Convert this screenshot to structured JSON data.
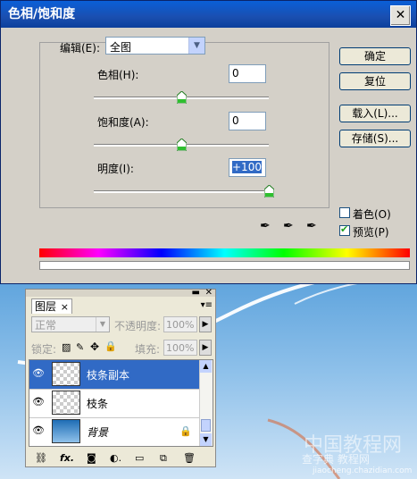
{
  "dialog": {
    "title": "色相/饱和度",
    "close_glyph": "✕",
    "edit_label": "编辑(E):",
    "edit_value": "全图",
    "hue_label": "色相(H):",
    "hue_value": "0",
    "saturation_label": "饱和度(A):",
    "saturation_value": "0",
    "lightness_label": "明度(I):",
    "lightness_value": "+100",
    "hue_level": 0.5,
    "saturation_level": 0.5,
    "lightness_level": 1.0,
    "buttons": {
      "ok": "确定",
      "reset": "复位",
      "load": "载入(L)...",
      "save": "存储(S)..."
    },
    "colorize_label": "着色(O)",
    "colorize_checked": false,
    "preview_label": "预览(P)",
    "preview_checked": true
  },
  "ruler": {
    "mark": "6"
  },
  "layers_panel": {
    "tab_label": "图层",
    "tab_close": "×",
    "blend_mode": "正常",
    "opacity_label": "不透明度:",
    "opacity_value": "100%",
    "lock_label": "锁定:",
    "fill_label": "填充:",
    "fill_value": "100%",
    "layers": [
      {
        "name": "枝条副本",
        "selected": true,
        "italic": false
      },
      {
        "name": "枝条",
        "selected": false,
        "italic": false
      },
      {
        "name": "背景",
        "selected": false,
        "italic": true,
        "locked": true
      }
    ]
  },
  "watermark": {
    "line1": "中国教程网",
    "line2": "查字典 教程网",
    "line3": "jiaocheng.chazidian.com"
  }
}
